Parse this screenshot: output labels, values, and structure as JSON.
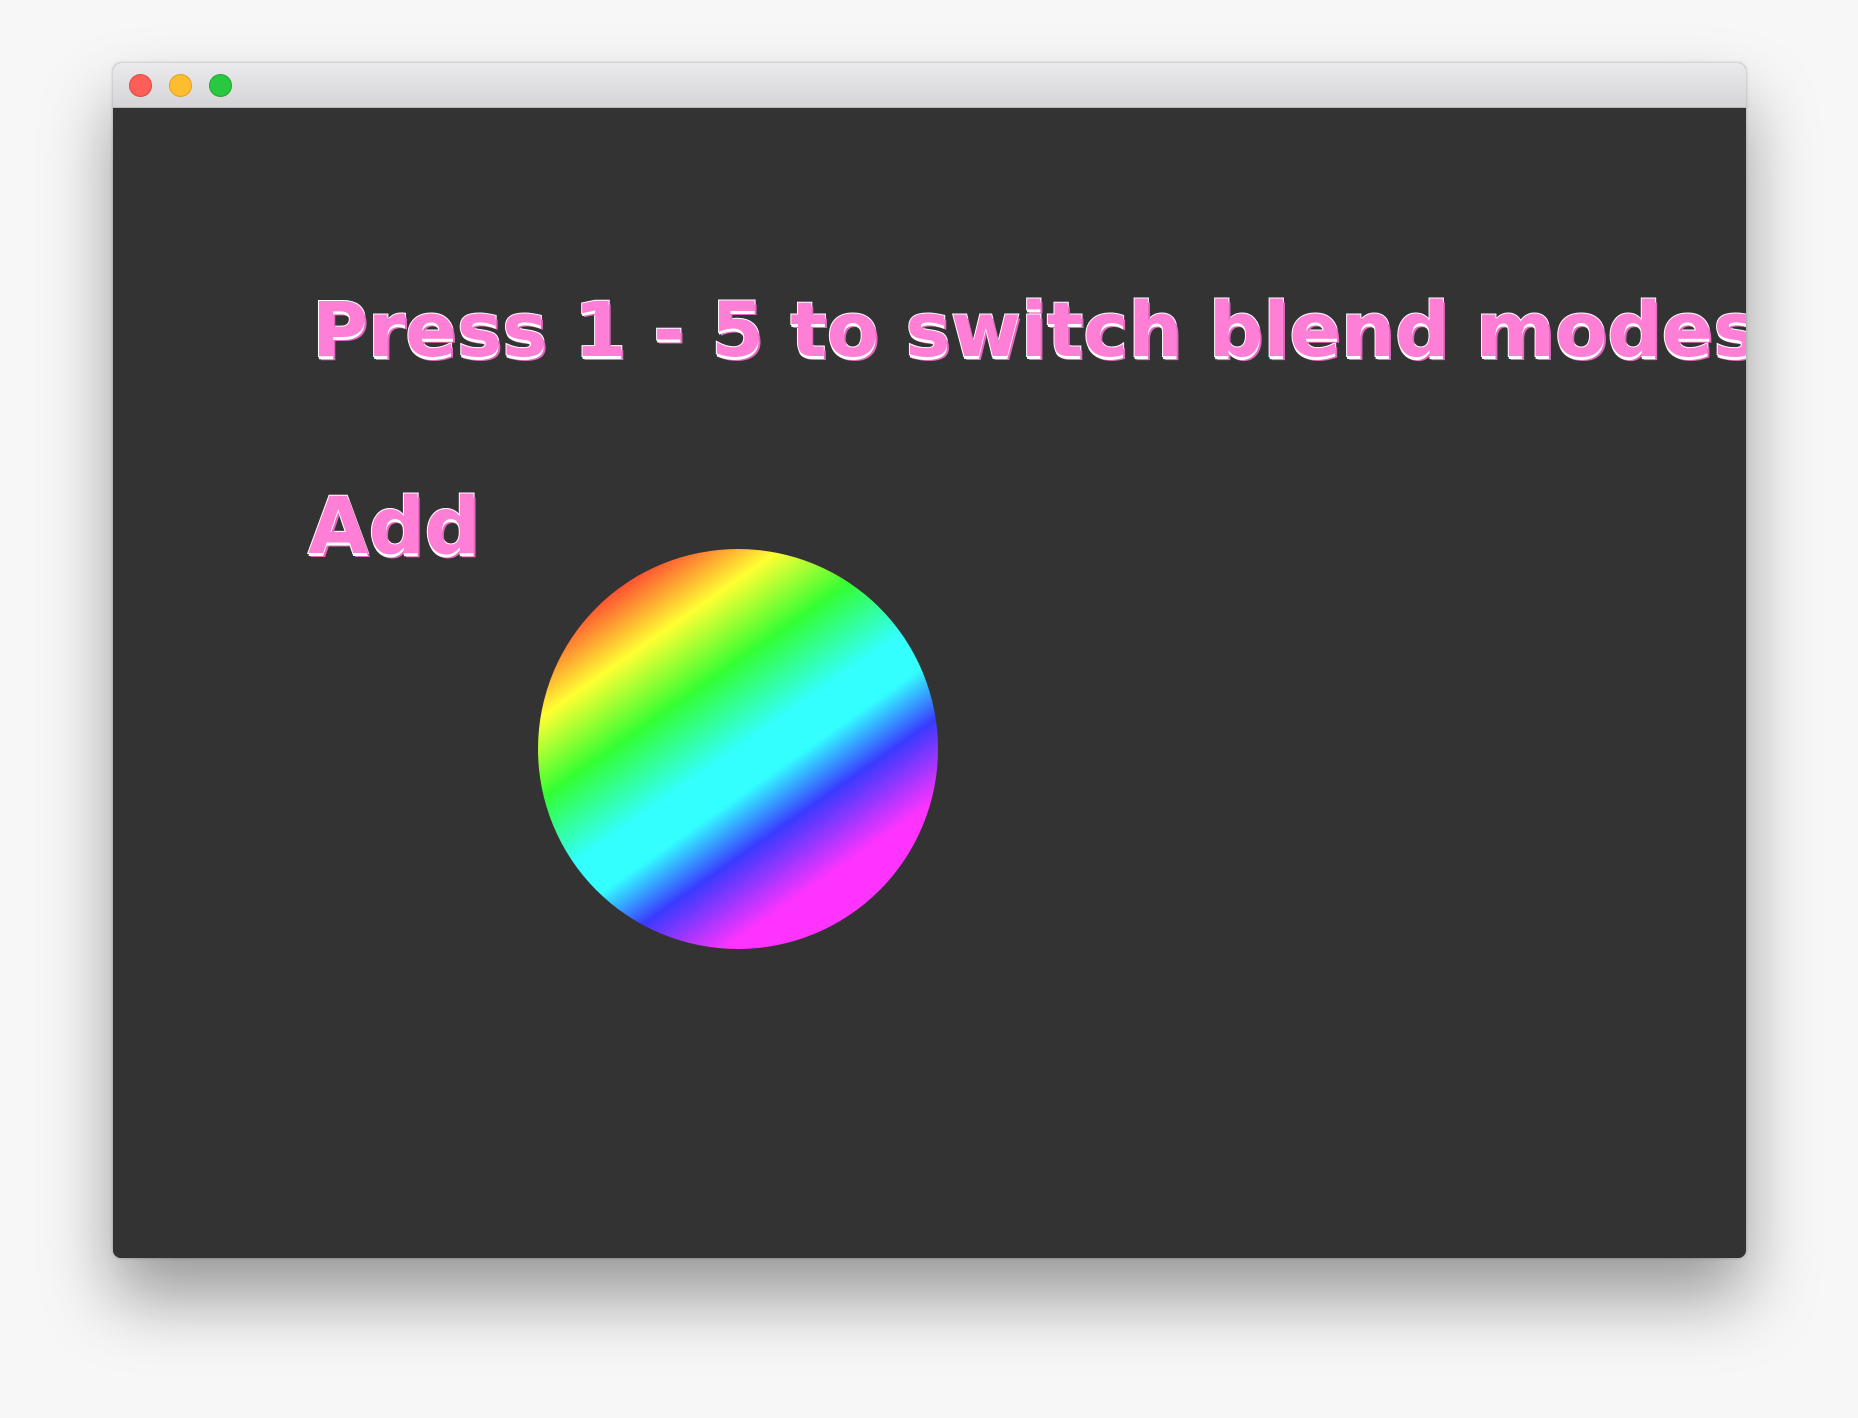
{
  "window": {
    "controls": {
      "close": "close-button",
      "minimize": "minimize-button",
      "zoom": "zoom-button"
    }
  },
  "canvas": {
    "instruction": "Press 1 - 5 to switch blend modes",
    "blend_mode": "Add",
    "shape": "rainbow-gradient-circle"
  },
  "colors": {
    "canvas_background": "#333333",
    "text_fill": "#ff7ed6",
    "text_outline": "#ffffff",
    "rainbow": [
      "#ff3131",
      "#ffff33",
      "#33ff33",
      "#33ffff",
      "#3a3aff",
      "#ff33ff"
    ]
  }
}
